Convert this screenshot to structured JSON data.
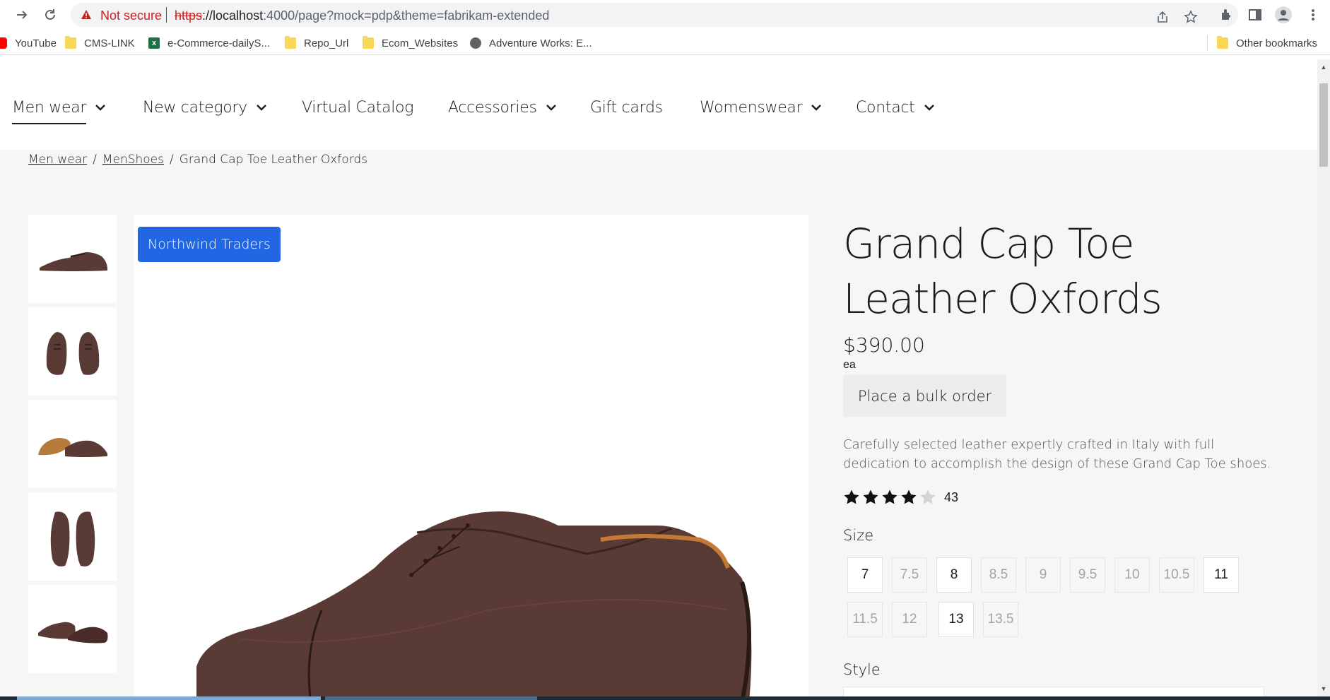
{
  "browser": {
    "security_label": "Not secure",
    "url_scheme": "https",
    "url_host": "://localhost",
    "url_rest": ":4000/page?mock=pdp&theme=fabrikam-extended"
  },
  "bookmarks": {
    "items": [
      {
        "label": "YouTube",
        "icon": "youtube-icon"
      },
      {
        "label": "CMS-LINK",
        "icon": "folder-icon"
      },
      {
        "label": "e-Commerce-dailyS...",
        "icon": "excel-icon"
      },
      {
        "label": "Repo_Url",
        "icon": "folder-icon"
      },
      {
        "label": "Ecom_Websites",
        "icon": "folder-icon"
      },
      {
        "label": "Adventure Works: E...",
        "icon": "globe-icon"
      }
    ],
    "other": "Other bookmarks"
  },
  "nav": {
    "items": [
      {
        "label": "Men wear"
      },
      {
        "label": "New category"
      },
      {
        "label": "Virtual Catalog"
      },
      {
        "label": "Accessories"
      },
      {
        "label": "Gift cards"
      },
      {
        "label": "Womenswear"
      },
      {
        "label": "Contact"
      }
    ]
  },
  "breadcrumb": {
    "items": [
      "Men wear",
      "MenShoes",
      "Grand Cap Toe Leather Oxfords"
    ],
    "separator": "/"
  },
  "product": {
    "brand_badge": "Northwind Traders",
    "title": "Grand Cap Toe Leather Oxfords",
    "price": "$390.00",
    "unit": "ea",
    "bulk_order_label": "Place a bulk order",
    "description": "Carefully selected leather expertly crafted in Italy with full dedication to accomplish the design of these Grand Cap Toe shoes.",
    "rating": 4,
    "rating_max": 5,
    "review_count": "43",
    "size_label": "Size",
    "sizes": [
      {
        "label": "7",
        "available": true
      },
      {
        "label": "7.5",
        "available": false
      },
      {
        "label": "8",
        "available": true
      },
      {
        "label": "8.5",
        "available": false
      },
      {
        "label": "9",
        "available": false
      },
      {
        "label": "9.5",
        "available": false
      },
      {
        "label": "10",
        "available": false
      },
      {
        "label": "10.5",
        "available": false
      },
      {
        "label": "11",
        "available": true
      },
      {
        "label": "11.5",
        "available": false
      },
      {
        "label": "12",
        "available": false
      },
      {
        "label": "13",
        "available": true
      },
      {
        "label": "13.5",
        "available": false
      }
    ],
    "style_label": "Style"
  },
  "colors": {
    "brand_badge": "#2266e3",
    "page_bg": "#f7f6f4",
    "shoe": "#5a3a34"
  }
}
